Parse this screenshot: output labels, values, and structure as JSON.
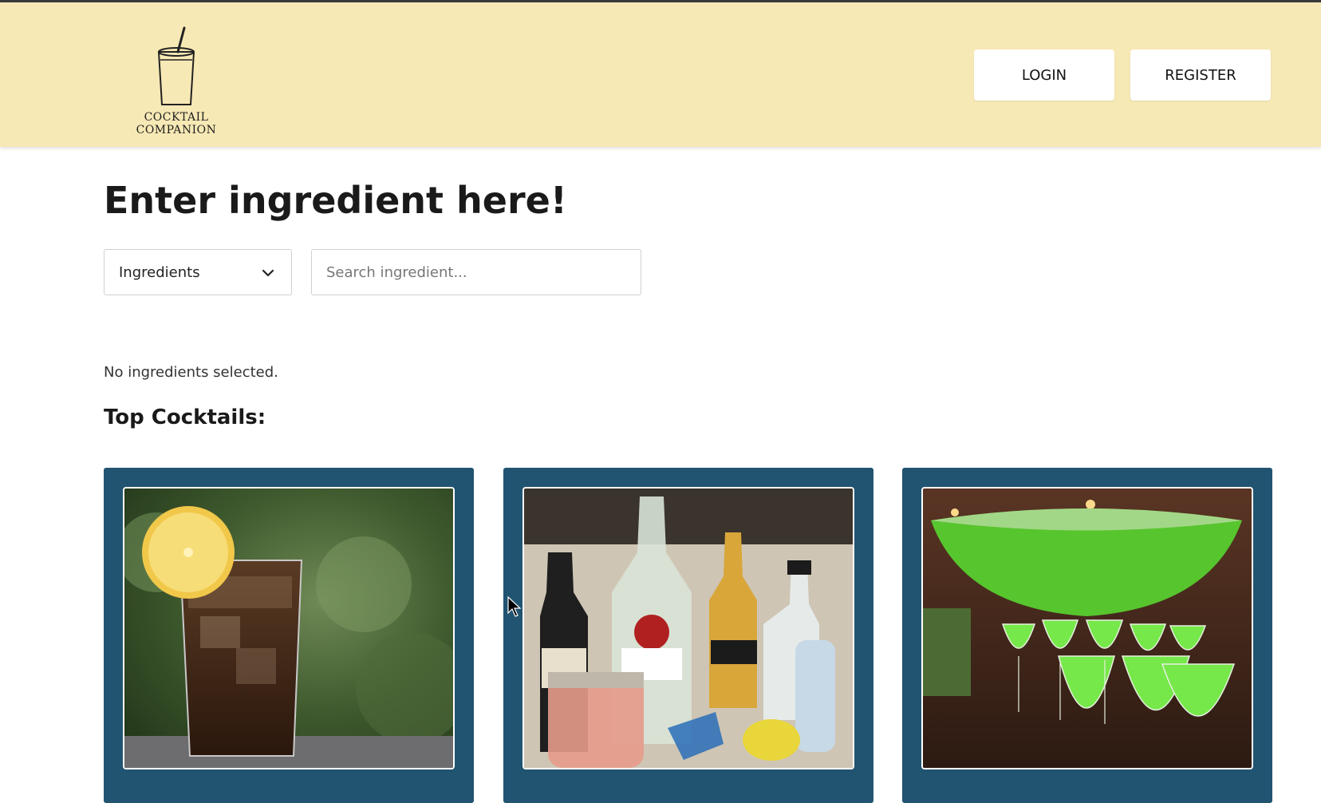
{
  "header": {
    "logo_text": "COCKTAIL COMPANION",
    "login_label": "LOGIN",
    "register_label": "REGISTER"
  },
  "main": {
    "title": "Enter ingredient here!",
    "dropdown": {
      "selected": "Ingredients"
    },
    "search": {
      "placeholder": "Search ingredient..."
    },
    "status": "No ingredients selected.",
    "section_title": "Top Cocktails:"
  },
  "cocktails": [
    {
      "image": "iced-cola-drink-with-lemon"
    },
    {
      "image": "liquor-bottles-and-mason-jar-drink"
    },
    {
      "image": "green-punch-bowl-with-glasses"
    }
  ],
  "colors": {
    "header_bg": "#f7e9b5",
    "card_bg": "#215470",
    "button_bg": "#ffffff"
  }
}
